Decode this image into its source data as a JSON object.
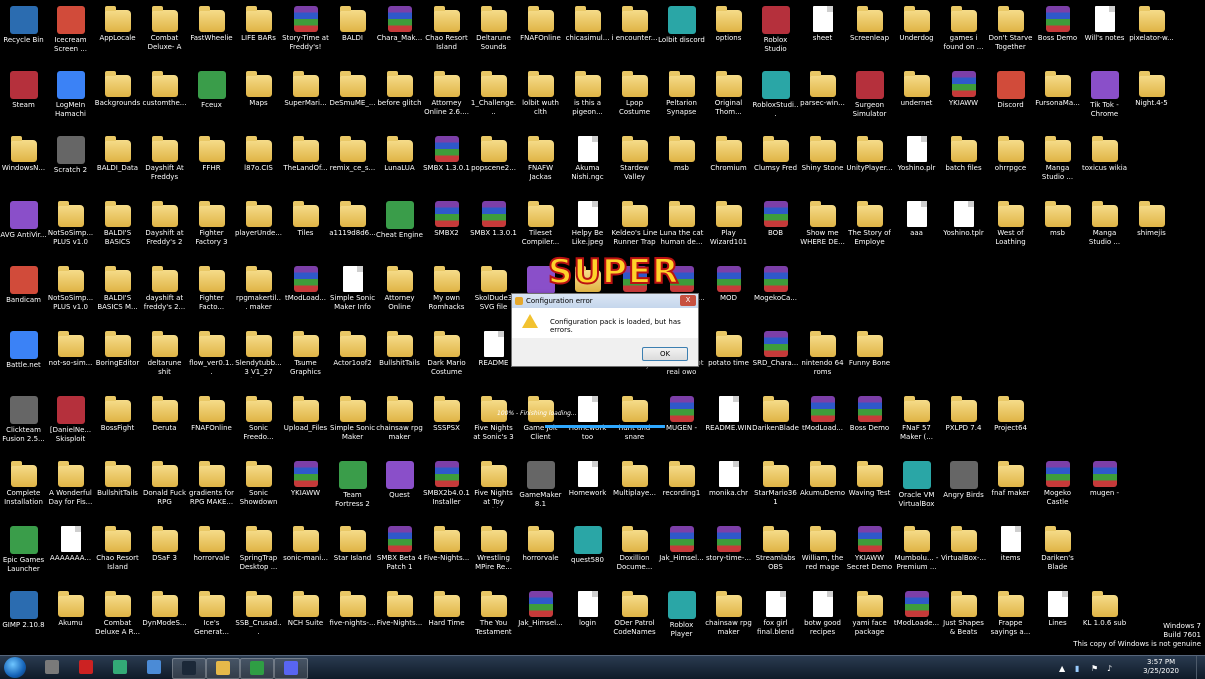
{
  "icons": [
    [
      "Recycle Bin",
      "Icecream Screen ...",
      "AppLocale",
      "Combat Deluxe- A R...",
      "FastWheelie",
      "LIFE BARs",
      "Story-Time at Freddy's!",
      "BALDI",
      "Chara_Mak...",
      "Chao Resort Island",
      "Deltarune Sounds",
      "FNAFOnline",
      "chicasimul...",
      "i encounter...",
      "Lolbit discord",
      "options",
      "Roblox Studio",
      "sheet",
      "Screenleap",
      "Underdog",
      "games i found on ...",
      "Don't Starve Together",
      "Boss Demo",
      "Will's notes",
      "pixelator-w..."
    ],
    [
      "Steam",
      "LogMeIn Hamachi",
      "Backgrounds",
      "customthe...",
      "Fceux",
      "Maps",
      "SuperMari...",
      "DeSmuME_...",
      "before glitch",
      "Attorney Online 2.6....",
      "1_Challenge...",
      "lolbit wuth clth",
      "is this a pigeon...",
      "Lpop Costume",
      "Peltarion Synapse",
      "Original Thom...",
      "RobloxStudi...",
      "parsec-win...",
      "Surgeon Simulator",
      "undernet",
      "YKIAWW",
      "Discord",
      "FursonaMa...",
      "Tik Tok - Chrome",
      "Night.4-5"
    ],
    [
      "WindowsN...",
      "Scratch 2",
      "BALDI_Data",
      "Dayshift At Freddys",
      "FFHR",
      "l87o.CIS",
      "TheLandOf...",
      "remix_ce_s...",
      "LunaLUA",
      "SMBX 1.3.0.1",
      "popscene2...",
      "FNAFW Jackas",
      "Akuma Nishi.ngc",
      "Stardew Valley",
      "msb",
      "Chromium",
      "Clumsy Fred",
      "Shiny Stone",
      "UnityPlayer...",
      "Yoshino.plr",
      "batch files",
      "ohrrpgce",
      "Manga Studio ...",
      "toxicus wikia"
    ],
    [
      "AVG AntiVir...",
      "NotSoSimp... PLUS v1.0",
      "BALDI'S BASICS",
      "Dayshift at Freddy's 2",
      "Fighter Factory 3 x86",
      "playerUnde...",
      "Tiles",
      "a1119d8d6...",
      "Cheat Engine",
      "SMBX2",
      "SMBX 1.3.0.1",
      "Tileset Compiler...",
      "Helpy Be Like.jpeg",
      "Keldeo's Line Runner Trap",
      "Luna the cat human de...",
      "Play Wizard101",
      "BOB",
      "Show me WHERE DE...",
      "The Story of Employe",
      "aaa",
      "Yoshino.tplr",
      "West of Loathing",
      "msb",
      "Manga Studio ...",
      "shimejis"
    ],
    [
      "Bandicam",
      "NotSoSimp... PLUS v1.0",
      "BALDI'S BASICS M...",
      "dayshift at freddy's 2...",
      "Fighter Facto...",
      "rpgmakertil... maker",
      "tModLoad...",
      "Simple Sonic Maker Info",
      "Attorney Online",
      "My own Romhacks",
      "SkolDude3 SVG file",
      "Clickteam Fusion 2.5...",
      "SuperMari...",
      "skeleton-t...",
      "SMAPI-2.11...",
      "MOD",
      "MogekoCa..."
    ],
    [
      "Battle.net",
      "not-so-sim...",
      "BoringEditor",
      "deltarune shit",
      "flow_ver0.1...",
      "Slendytubb... 3 V1_27 (64...",
      "Tsume Graphics",
      "Actor1oof2",
      "BullshitTails",
      "Dark Mario Costume",
      "README",
      "rpg2003_rt...",
      "BOB",
      "Audacity",
      "diseases not real owo",
      "potato time",
      "SRD_Chara...",
      "nintendo 64 roms",
      "Funny Bone"
    ],
    [
      "Clickteam Fusion 2.5...",
      "[DanielNe... Skisploit",
      "BossFight",
      "Deruta",
      "FNAFOnline",
      "Sonic Freedo...",
      "Upload_Files",
      "Simple Sonic Maker",
      "chainsaw rpg maker",
      "SSSPSX",
      "Five Nights at Sonic's 3",
      "Game Jolt Client",
      "Homework too",
      "hunt and snare",
      "MUGEN -",
      "README.WIN",
      "DarikenBlade",
      "tModLoad...",
      "Boss Demo",
      "FNaF 57 Maker (...",
      "PXLPD 7.4",
      "Project64"
    ],
    [
      "Complete Installation ...",
      "A Wonderful Day for Fis...",
      "BullshitTails",
      "Donald Fuck RPG",
      "gradients for RPG MAKE...",
      "Sonic Showdown",
      "YKIAWW",
      "Team Fortress 2",
      "Quest",
      "SMBX2b4.0.1 Installer",
      "Five Nights at Toy Freddy's",
      "GameMaker 8.1",
      "Homework",
      "Multiplaye...",
      "recording1",
      "monika.chr",
      "StarMario361",
      "AkumuDemo",
      "Waving Test",
      "Oracle VM VirtualBox",
      "Angry Birds",
      "fnaf maker",
      "Mogeko Castle",
      "mugen -"
    ],
    [
      "Epic Games Launcher",
      "AAAAAAA...",
      "Chao Resort Island",
      "DSaF 3",
      "horrorvale",
      "SpringTrap Desktop ...",
      "sonic-mani...",
      "Star Island",
      "SMBX Beta 4 Patch 1",
      "Five-Nights...",
      "Wrestling MPire Re...",
      "horrorvale",
      "quest580",
      "Doxillion Docume...",
      "Jak_Himsel...",
      "story-time-...",
      "Streamlabs OBS",
      "William, the red mage",
      "YKIAWW Secret Demo",
      "Mumbolu... - Premium ...",
      "VirtualBox-...",
      "items",
      "Dariken's Blade"
    ],
    [
      "GIMP 2.10.8",
      "Akumu",
      "Combat Deluxe A R...",
      "DynModeS...",
      "Ice's Generat...",
      "SSB_Crusad...",
      "NCH Suite",
      "five-nights-...",
      "Five-Nights...",
      "Hard Time",
      "The You Testament",
      "Jak_Himsel...",
      "login",
      "ODer Patrol CodeNames",
      "Roblox Player",
      "chainsaw rpg maker",
      "fox girl final.blend",
      "botw good recipes",
      "yami face package",
      "tModLoade...",
      "Just Shapes & Beats",
      "Frappe sayings a...",
      "Lines",
      "KL 1.0.6 sub"
    ]
  ],
  "dialog": {
    "title": "Configuration error",
    "message": "Configuration pack is loaded, but has errors.",
    "ok_label": "OK",
    "close_label": "X"
  },
  "splash": {
    "title": "SUPER",
    "loading_text": "100% - Finishing loading...",
    "progress": 1.0
  },
  "taskbar": {
    "apps": [
      "media-icon",
      "red-ball-icon",
      "window-icon",
      "chromium-icon",
      "steam-icon",
      "explorer-icon",
      "chrome-icon",
      "discord-icon"
    ],
    "active_index": [
      4,
      5,
      6,
      7
    ]
  },
  "clock": {
    "time": "3:57 PM",
    "date": "3/25/2020"
  },
  "watermark": {
    "line1": "Windows 7",
    "line2": "Build 7601",
    "line3": "This copy of Windows is not genuine"
  },
  "colors": {
    "accent": "#2ea8ff",
    "folder": "#e0b445",
    "taskbar": "#1b2a3d"
  }
}
